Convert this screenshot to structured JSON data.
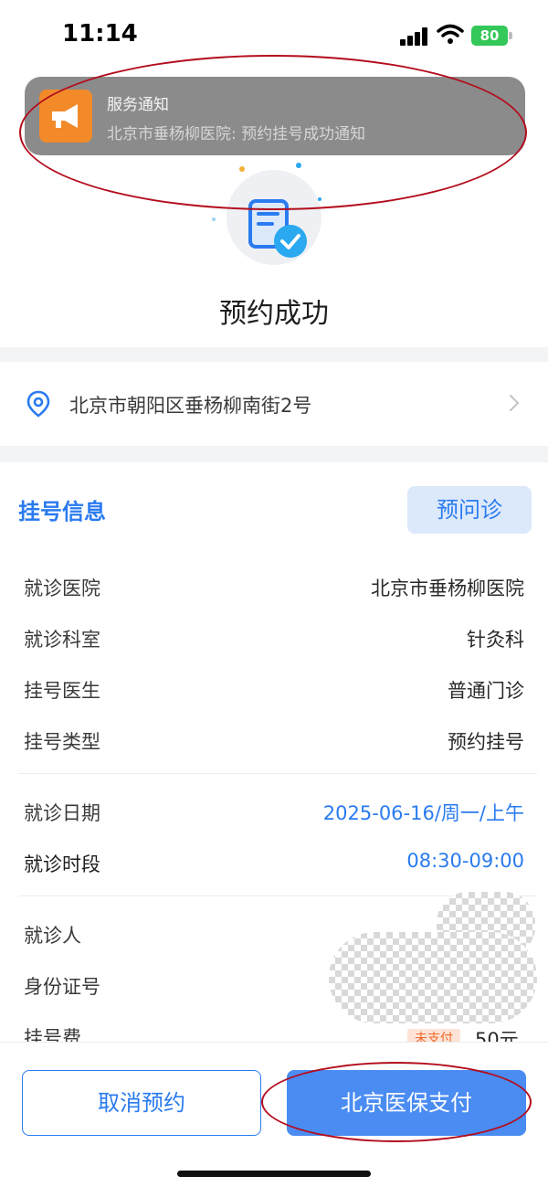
{
  "status_bar": {
    "time": "11:14",
    "battery": "80"
  },
  "notification": {
    "title": "服务通知",
    "text": "北京市垂杨柳医院: 预约挂号成功通知",
    "icon": "megaphone-icon",
    "icon_color": "#f28a2a"
  },
  "header": {
    "title": "预约成功"
  },
  "address": {
    "text": "北京市朝阳区垂杨柳南街2号"
  },
  "info": {
    "section_title": "挂号信息",
    "pre_consult_button": "预问诊",
    "rows": [
      {
        "label": "就诊医院",
        "value": "北京市垂杨柳医院"
      },
      {
        "label": "就诊科室",
        "value": "针灸科"
      },
      {
        "label": "挂号医生",
        "value": "普通门诊"
      },
      {
        "label": "挂号类型",
        "value": "预约挂号"
      },
      {
        "label": "就诊日期",
        "value": "2025-06-16/周一/上午"
      },
      {
        "label": "就诊时段",
        "value": "08:30-09:00"
      },
      {
        "label": "就诊人",
        "value": ""
      },
      {
        "label": "身份证号",
        "value": ""
      },
      {
        "label": "挂号费",
        "value": "50元",
        "badge": "未支付"
      }
    ]
  },
  "actions": {
    "cancel": "取消预约",
    "pay": "北京医保支付"
  },
  "colors": {
    "accent": "#2a7bf0",
    "annotation": "#b30d1d",
    "badge_text": "#ef6a2a"
  }
}
